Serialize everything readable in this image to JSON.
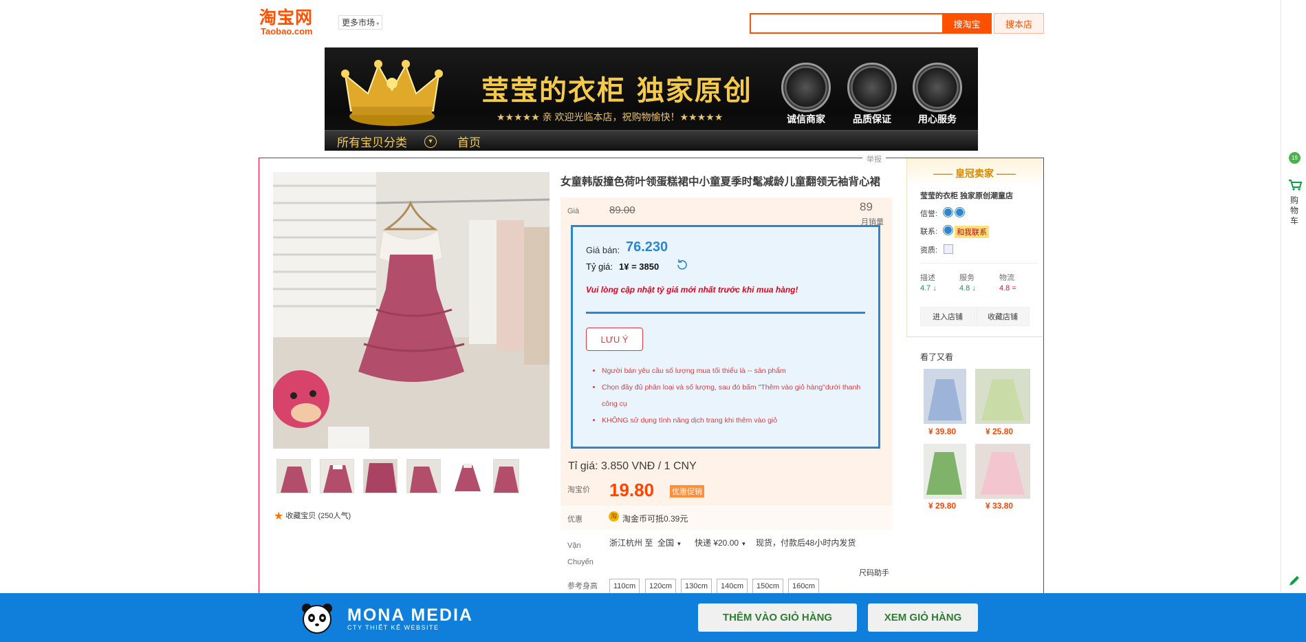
{
  "header": {
    "logo_cn": "淘宝网",
    "logo_en": "Taobao.com",
    "more_market": "更多市场",
    "search_placeholder": "",
    "search_taobao_btn": "搜淘宝",
    "search_shop_btn": "搜本店"
  },
  "banner": {
    "shop_title": "莹莹的衣柜 独家原创",
    "slogan": "★★★★★ 亲 欢迎光临本店，祝购物愉快！★★★★★",
    "badges": [
      "诚信商家",
      "品质保证",
      "用心服务"
    ],
    "nav_all": "所有宝贝分类",
    "nav_home": "首页"
  },
  "report": "举报",
  "gallery": {
    "favorite_text": "收藏宝贝 (250人气)"
  },
  "product": {
    "title": "女童韩版撞色荷叶领蛋糕裙中小童夏季时髦减龄儿童翻领无袖背心裙",
    "orig_price_label": "Giá",
    "orig_price": "89.00",
    "sales_count": "89",
    "sales_label": "月销量",
    "ti_gia": "Tỉ giá: 3.850 VNĐ / 1 CNY",
    "taobao_price_label": "淘宝价",
    "taobao_price": "19.80",
    "promo_badge": "优惠促销",
    "youhui_label": "优惠",
    "coin_icon_text": "淘",
    "youhui_text": "淘金币可抵0.39元",
    "shipping_label": "Vận Chuyển",
    "ship_from": "浙江杭州 至",
    "ship_to": "全国",
    "ship_fee": "快递 ¥20.00",
    "ship_note": "现货，付款后48小时内发货",
    "size_helper": "尺码助手",
    "height_label": "参考身高",
    "sizes": [
      "110cm",
      "120cm",
      "130cm",
      "140cm",
      "150cm",
      "160cm"
    ]
  },
  "vn_popup": {
    "sale_label": "Giá bán:",
    "sale_value": "76.230",
    "rate_label": "Tỷ giá:",
    "rate_value": "1¥ = 3850",
    "warning": "Vui lòng cập nhật tỷ giá mới nhất trước khi mua hàng!",
    "save_btn": "LƯU Ý",
    "notes": [
      "Người bán yêu cầu số lượng mua tối thiểu là -- sản phẩm",
      "Chọn đầy đủ phân loại và số lượng, sau đó bấm \"Thêm vào giỏ hàng\"dưới thanh công cụ",
      "KHÔNG sử dụng tính năng dịch trang khi thêm vào giỏ"
    ]
  },
  "seller": {
    "head": "皇冠卖家",
    "name": "莹莹的衣柜 独家原创潮童店",
    "credit_label": "信誉:",
    "contact_label": "联系:",
    "contact_btn": "和我联系",
    "qual_label": "资质:",
    "ratings": [
      {
        "label": "描述",
        "value": "4.7",
        "trend": "↓",
        "color": "#0a9e45"
      },
      {
        "label": "服务",
        "value": "4.8",
        "trend": "↓",
        "color": "#0a9e45"
      },
      {
        "label": "物流",
        "value": "4.8",
        "trend": "=",
        "color": "#ff0036"
      }
    ],
    "enter_shop": "进入店铺",
    "fav_shop": "收藏店铺",
    "also_viewed": "看了又看",
    "recommend": [
      {
        "price": "¥ 39.80"
      },
      {
        "price": "¥ 25.80"
      },
      {
        "price": "¥ 29.80"
      },
      {
        "price": "¥ 33.80"
      }
    ]
  },
  "rail": {
    "coin_text": "19",
    "cart_text": "购物车"
  },
  "bottom": {
    "brand": "MONA MEDIA",
    "sub": "CTY THIẾT KẾ WEBSITE",
    "add_to_cart": "THÊM VÀO GIỎ HÀNG",
    "view_cart": "XEM GIỎ HÀNG"
  },
  "colors": {
    "taobao_orange": "#ff5000",
    "popup_blue": "#2b86cf",
    "bottom_bar": "#0f7fdb",
    "main_border": "#ff0036"
  }
}
